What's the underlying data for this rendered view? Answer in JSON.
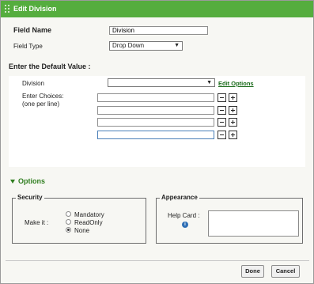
{
  "dialog": {
    "title": "Edit Division"
  },
  "form": {
    "field_name_label": "Field Name",
    "field_name_value": "Division",
    "field_type_label": "Field Type",
    "field_type_value": "Drop Down",
    "default_value_heading": "Enter the Default Value :",
    "division_label": "Division",
    "division_value": "",
    "edit_options_link": "Edit Options",
    "choices_label": "Enter Choices:",
    "choices_sublabel": "(one per line)",
    "choices": [
      "",
      "",
      "",
      ""
    ]
  },
  "options": {
    "heading": "Options",
    "security": {
      "legend": "Security",
      "make_it_label": "Make it :",
      "radios": [
        {
          "label": "Mandatory",
          "selected": false
        },
        {
          "label": "ReadOnly",
          "selected": false
        },
        {
          "label": "None",
          "selected": true
        }
      ]
    },
    "appearance": {
      "legend": "Appearance",
      "help_card_label": "Help Card :",
      "help_icon": "info-icon",
      "help_card_value": ""
    }
  },
  "footer": {
    "done_label": "Done",
    "cancel_label": "Cancel"
  },
  "colors": {
    "title_bar": "#55ad3e",
    "link_green": "#1a6b1a",
    "info_blue": "#2f6fb5"
  }
}
